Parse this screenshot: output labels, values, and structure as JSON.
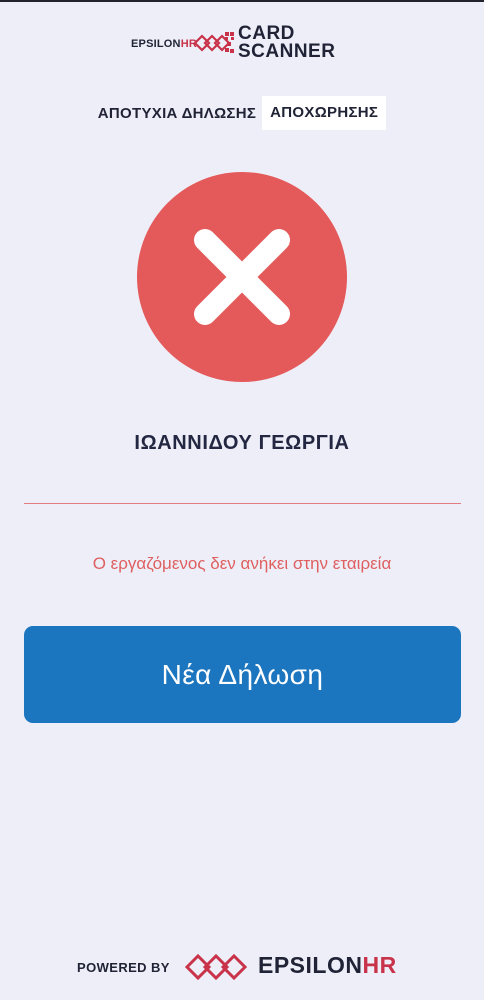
{
  "header": {
    "brand_prefix": "EPSILON",
    "brand_suffix": "HR",
    "product_line1": "CARD",
    "product_line2": "SCANNER"
  },
  "status": {
    "title": "ΑΠΟΤΥΧΙΑ ΔΗΛΩΣΗΣ",
    "type_tag": "ΑΠΟΧΩΡΗΣΗΣ"
  },
  "result": {
    "icon": "close-icon",
    "employee_name": "ΙΩΑΝΝΙΔΟΥ ΓΕΩΡΓΙΑ",
    "error_message": "Ο εργαζόμενος δεν ανήκει στην εταιρεία"
  },
  "actions": {
    "new_declaration_label": "Νέα Δήλωση"
  },
  "footer": {
    "powered_by": "POWERED BY",
    "brand_prefix": "EPSILON",
    "brand_suffix": "HR"
  },
  "colors": {
    "background": "#eeeef8",
    "error": "#e45a5a",
    "button": "#1b75bf",
    "brand_red": "#c8334a",
    "text_dark": "#1f2335"
  }
}
